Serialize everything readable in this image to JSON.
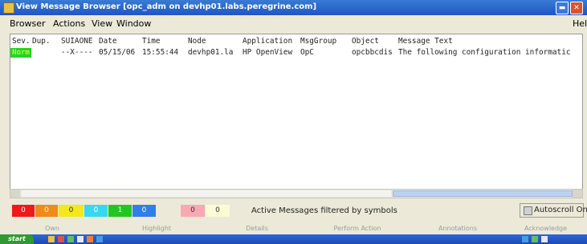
{
  "window": {
    "title": "View Message Browser  [opc_adm on devhp01.labs.peregrine.com]",
    "min_icon": "minimize-icon",
    "close_icon": "close-icon"
  },
  "menu": {
    "items": [
      "Browser",
      "Actions",
      "View",
      "Window"
    ],
    "help": "Help"
  },
  "columns": [
    "Sev.",
    "Dup.",
    "SUIAONE",
    "Date",
    "Time",
    "Node",
    "Application",
    "MsgGroup",
    "Object",
    "Message Text"
  ],
  "messages": [
    {
      "severity": "Norm",
      "flags": "--X----",
      "date": "05/15/06",
      "time": "15:55:44",
      "node": "devhp01.la",
      "application": "HP OpenView",
      "msggroup": "OpC",
      "object": "opcbbcdis",
      "text": "The following configuration informatic"
    }
  ],
  "counters": [
    {
      "value": "0",
      "color": "#f01818"
    },
    {
      "value": "0",
      "color": "#f08a18"
    },
    {
      "value": "0",
      "color": "#f2e81a"
    },
    {
      "value": "0",
      "color": "#36d8f0"
    },
    {
      "value": "1",
      "color": "#22c622"
    },
    {
      "value": "0",
      "color": "#2f7fe8"
    },
    {
      "value": "0",
      "color": "#f9a9b4"
    },
    {
      "value": "0",
      "color": "#fbfbd6"
    }
  ],
  "status": {
    "filter_text": "Active Messages filtered by  symbols",
    "autoscroll_label": "Autoscroll On"
  },
  "actions": [
    "Own",
    "Highlight",
    "Details",
    "Perform Action",
    "Annotations",
    "Acknowledge"
  ],
  "taskbar": {
    "start_label": "start"
  },
  "colors": {
    "title_bar": "#1f55c6",
    "severity_normal": "#21d52a",
    "scroll_thumb": "#bcd1ef"
  }
}
